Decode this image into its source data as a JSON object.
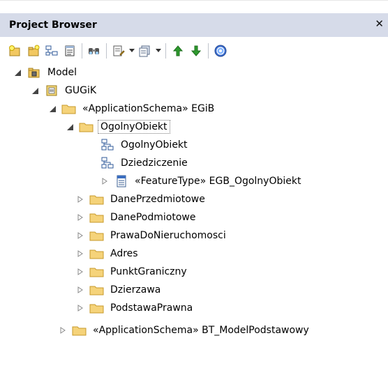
{
  "panel": {
    "title": "Project Browser",
    "close_glyph": "✕"
  },
  "toolbar": {
    "buttons": [
      "new-package-icon",
      "new-diagram-icon",
      "new-element-icon",
      "properties-icon",
      "find-icon",
      "new-document-icon",
      "options-icon",
      "move-up-icon",
      "move-down-icon",
      "help-icon"
    ]
  },
  "tree": {
    "model": "Model",
    "gugik": "GUGiK",
    "egib": "«ApplicationSchema» EGiB",
    "ogolny": "OgolnyObiekt",
    "diag_ogolny": "OgolnyObiekt",
    "diag_dziedziczenie": "Dziedziczenie",
    "feature": "«FeatureType» EGB_OgolnyObiekt",
    "dane_przedmiotowe": "DanePrzedmiotowe",
    "dane_podmiotowe": "DanePodmiotowe",
    "prawa": "PrawaDoNieruchomosci",
    "adres": "Adres",
    "punkt": "PunktGraniczny",
    "dzierzawa": "Dzierzawa",
    "podstawa": "PodstawaPrawna",
    "bt_model": "«ApplicationSchema» BT_ModelPodstawowy"
  },
  "colors": {
    "title_bar": "#d6dbe9",
    "folder_fill": "#f5d37a",
    "folder_border": "#c79a2b",
    "arrow_up": "#2e9a2e",
    "arrow_down": "#2e9a2e"
  }
}
